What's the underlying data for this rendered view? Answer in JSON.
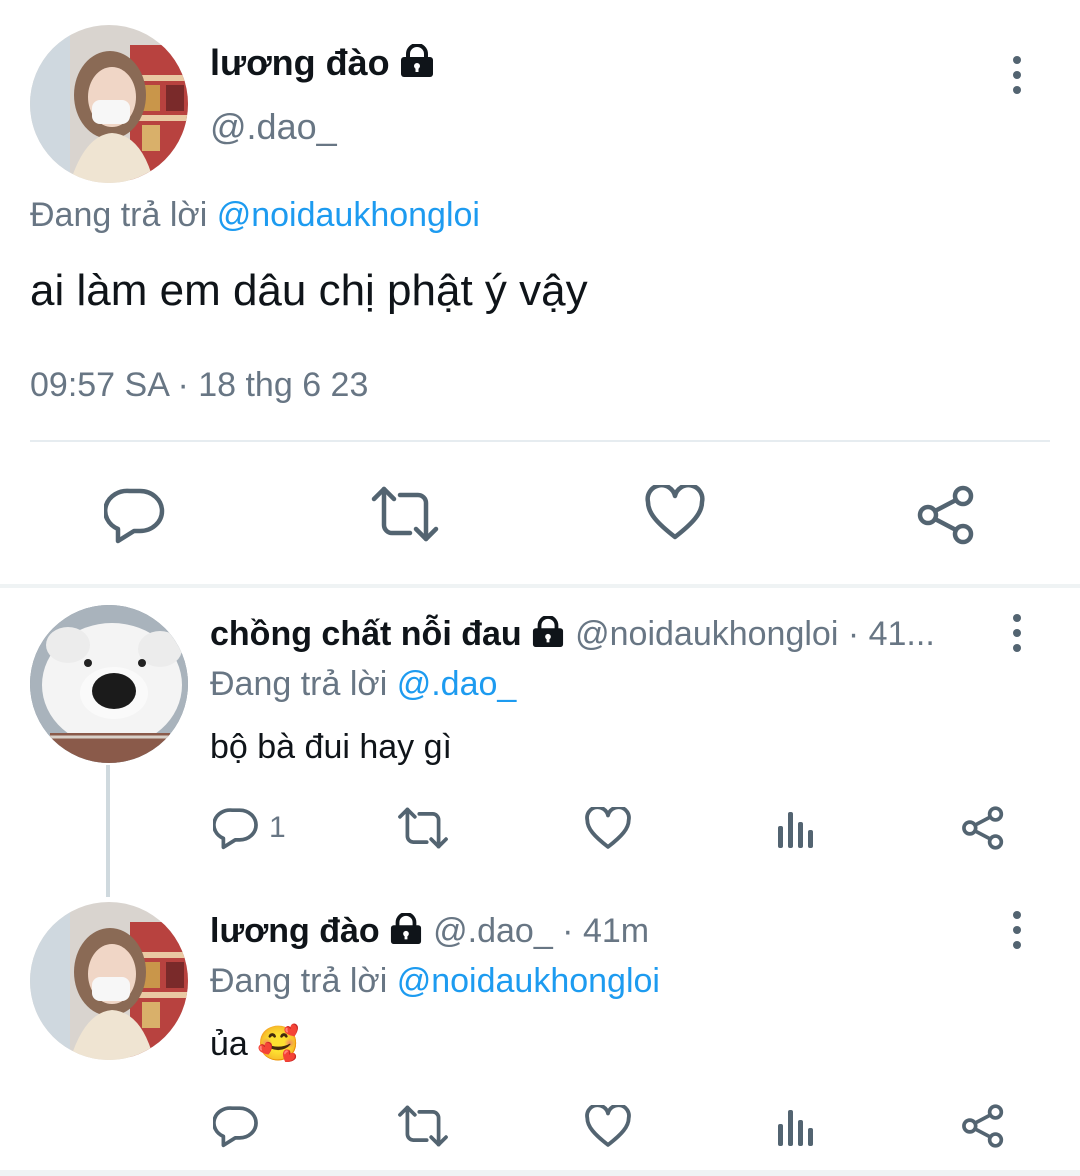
{
  "main_tweet": {
    "display_name": "lương đào",
    "handle": "@.dao_",
    "reply_prefix": "Đang trả lời",
    "reply_to": "@noidaukhongloi",
    "text": "ai làm em dâu chị phật ý vậy",
    "timestamp": "09:57 SA · 18 thg 6 23"
  },
  "replies": [
    {
      "display_name": "chồng chất nỗi đau",
      "handle_time": "@noidaukhongloi · 41...",
      "reply_prefix": "Đang trả lời",
      "reply_to": "@.dao_",
      "text": "bộ bà đui hay gì",
      "reply_count": "1"
    },
    {
      "display_name": "lương đào",
      "handle_time": "@.dao_ · 41m",
      "reply_prefix": "Đang trả lời",
      "reply_to": "@noidaukhongloi",
      "text": "ủa 🥰",
      "reply_count": ""
    }
  ],
  "colors": {
    "link": "#1d9bf0",
    "muted": "#687684",
    "icon": "#536471",
    "divider": "#e6ecf0"
  }
}
